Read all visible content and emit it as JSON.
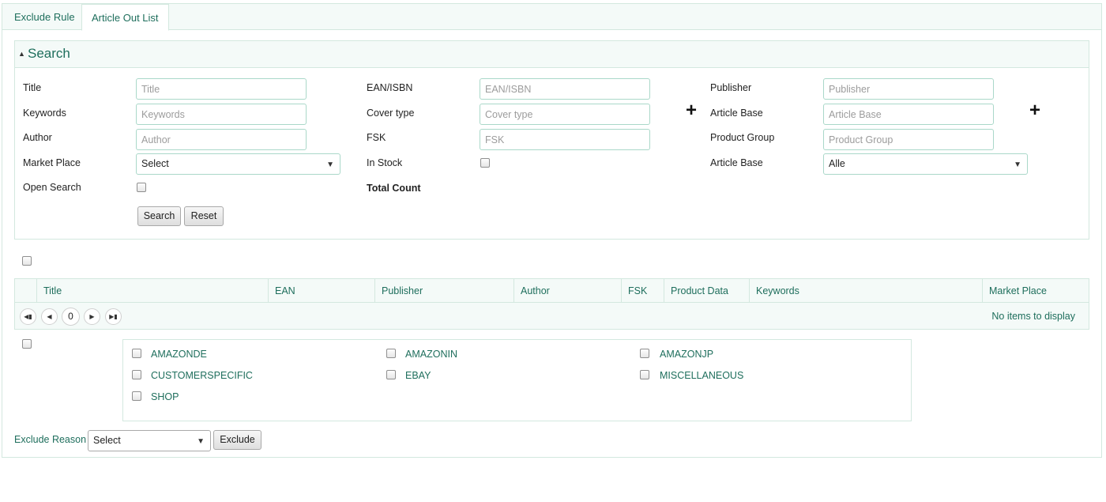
{
  "tabs": [
    {
      "label": "Exclude Rule",
      "active": false
    },
    {
      "label": "Article Out List",
      "active": true
    }
  ],
  "search": {
    "title": "Search",
    "fields": {
      "title": {
        "label": "Title",
        "placeholder": "Title"
      },
      "keywords": {
        "label": "Keywords",
        "placeholder": "Keywords"
      },
      "author": {
        "label": "Author",
        "placeholder": "Author"
      },
      "market_place": {
        "label": "Market Place",
        "value": "Select"
      },
      "open_search": {
        "label": "Open Search"
      },
      "ean": {
        "label": "EAN/ISBN",
        "placeholder": "EAN/ISBN"
      },
      "cover_type": {
        "label": "Cover type",
        "placeholder": "Cover type"
      },
      "fsk": {
        "label": "FSK",
        "placeholder": "FSK"
      },
      "in_stock": {
        "label": "In Stock"
      },
      "total_count": {
        "label": "Total Count"
      },
      "publisher": {
        "label": "Publisher",
        "placeholder": "Publisher"
      },
      "article_base": {
        "label": "Article Base",
        "placeholder": "Article Base"
      },
      "product_group": {
        "label": "Product Group",
        "placeholder": "Product Group"
      },
      "article_base_select": {
        "label": "Article Base",
        "value": "Alle"
      }
    },
    "plus_symbol": "+",
    "search_button": "Search",
    "reset_button": "Reset"
  },
  "grid": {
    "columns": [
      "Title",
      "EAN",
      "Publisher",
      "Author",
      "FSK",
      "Product Data",
      "Keywords",
      "Market Place"
    ],
    "pager": {
      "page": "0",
      "status": "No items to display"
    }
  },
  "market_places": [
    "AMAZONDE",
    "AMAZONIN",
    "AMAZONJP",
    "CUSTOMERSPECIFIC",
    "EBAY",
    "MISCELLANEOUS",
    "SHOP"
  ],
  "exclude": {
    "reason_label": "Exclude Reason",
    "reason_value": "Select",
    "button": "Exclude"
  },
  "icons": {
    "select_arrow": "▼",
    "collapse_triangle": "▲",
    "pager_first": "first-page-icon",
    "pager_prev": "prev-page-icon",
    "pager_next": "next-page-icon",
    "pager_last": "last-page-icon"
  },
  "colors": {
    "accent_text": "#1e6e5c",
    "border": "#d3e8df",
    "input_border": "#aad8c9",
    "header_bg": "#f4faf8"
  }
}
